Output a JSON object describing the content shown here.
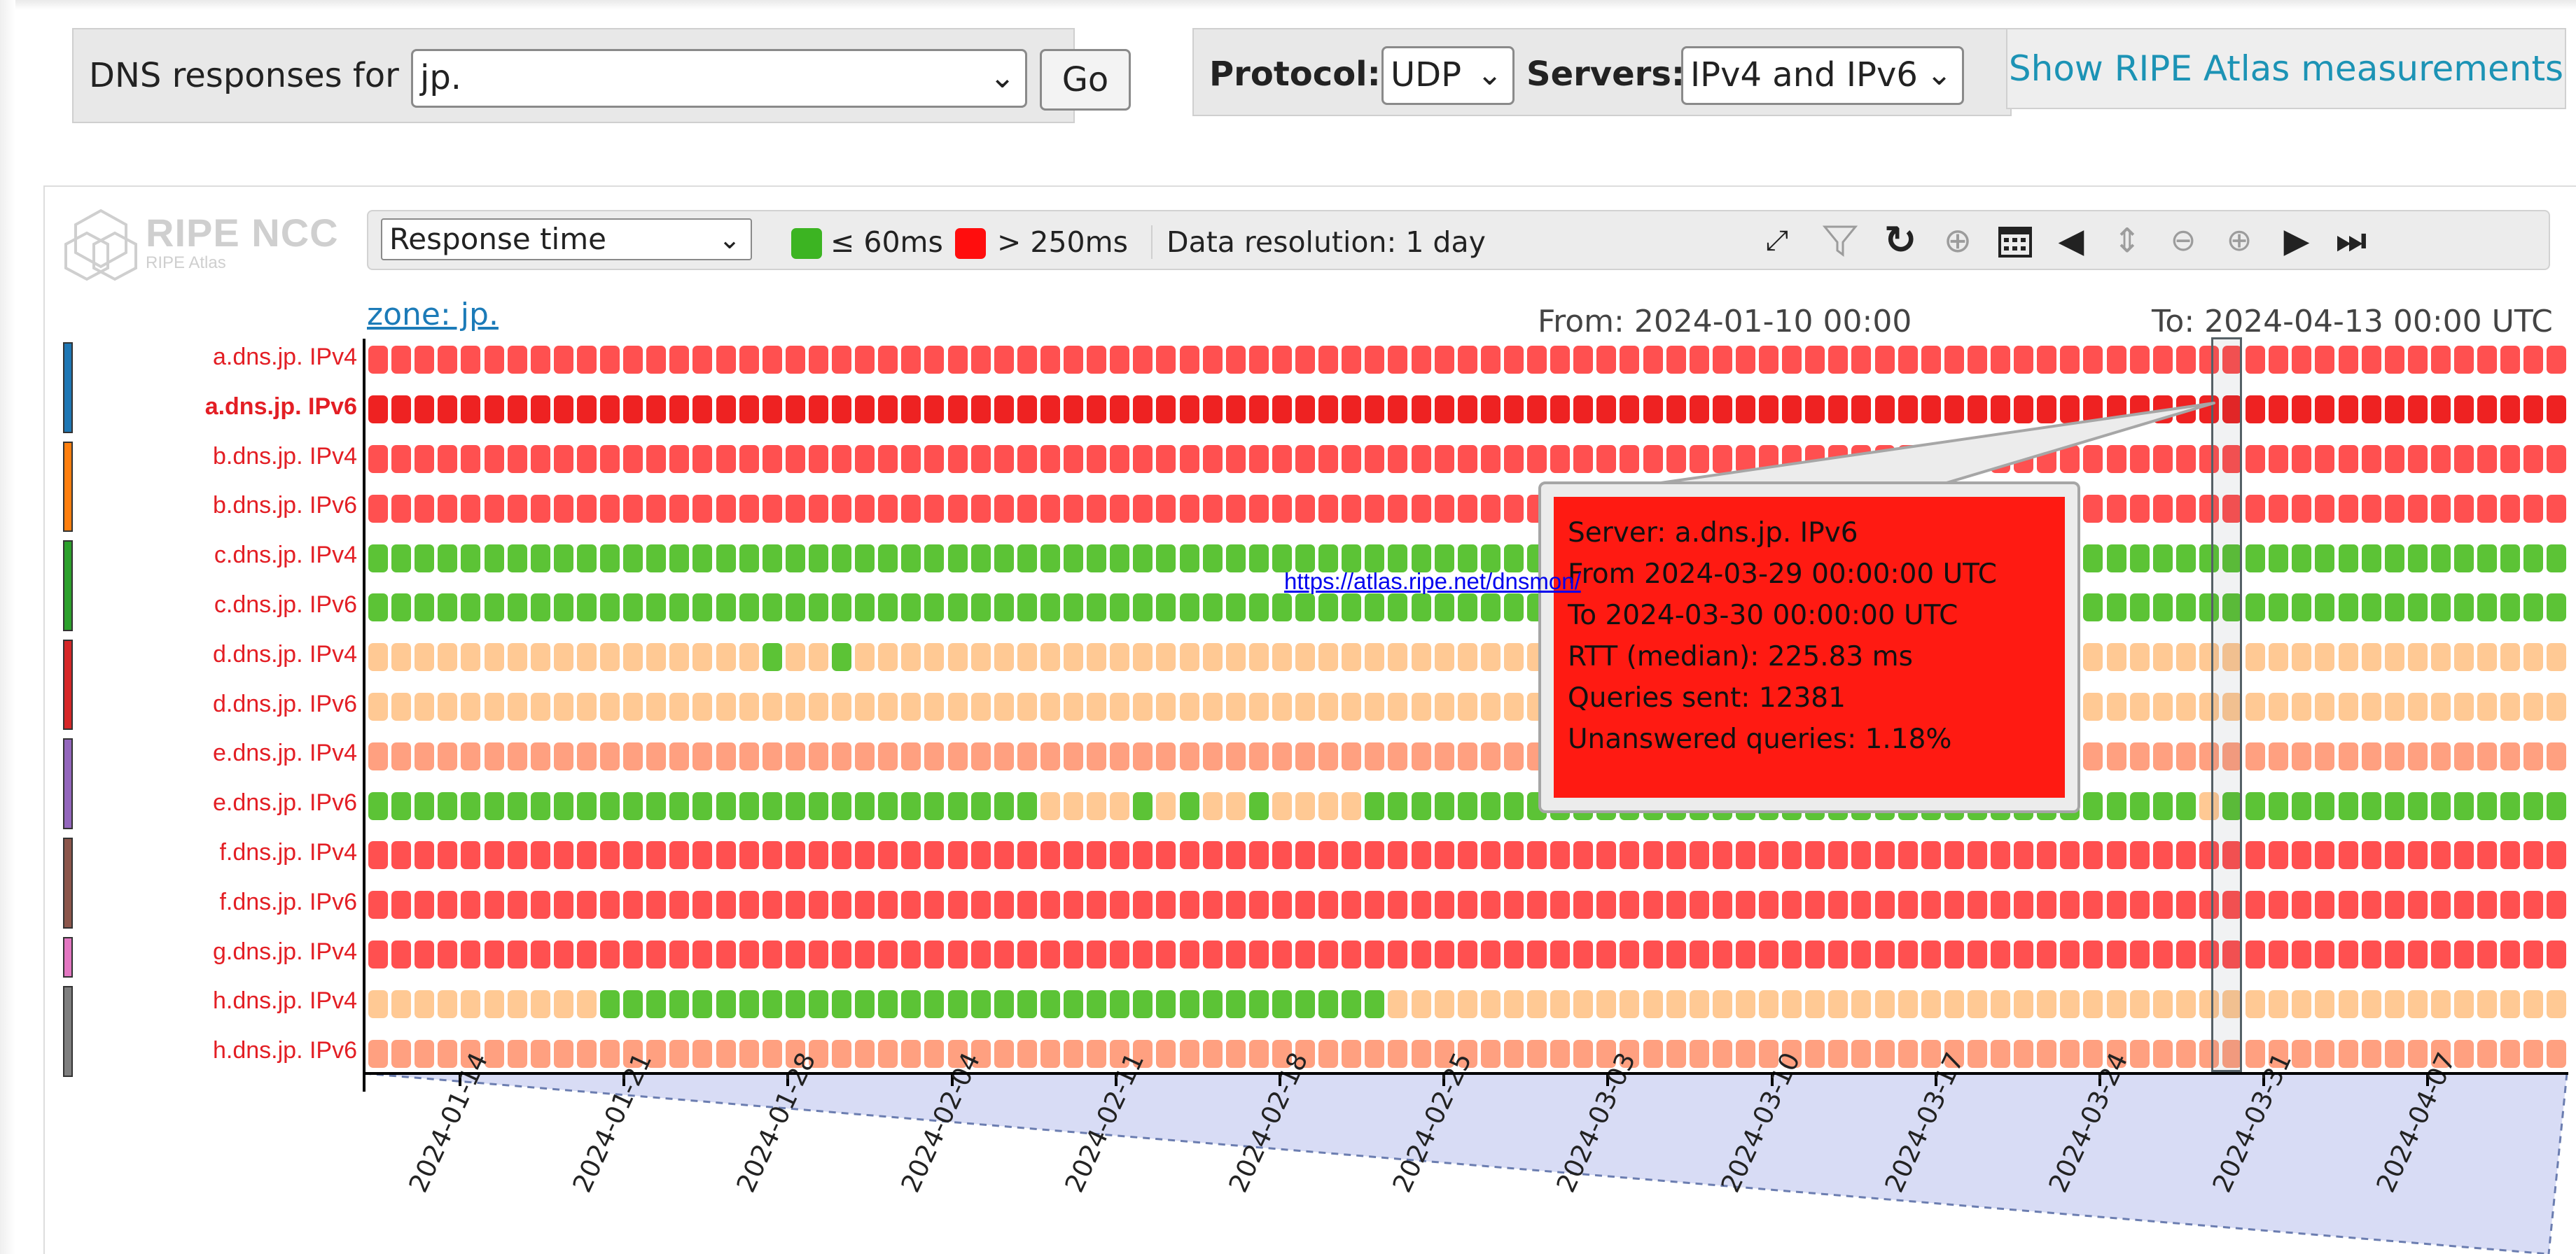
{
  "top_bar": {
    "dns_label": "DNS responses for",
    "zone_value": "jp.",
    "go_label": "Go",
    "protocol_label": "Protocol:",
    "protocol_value": "UDP",
    "servers_label": "Servers:",
    "servers_value": "IPv4 and IPv6",
    "ripe_button": "Show RIPE Atlas measurements"
  },
  "logo": {
    "name": "RIPE NCC",
    "sub": "RIPE Atlas"
  },
  "toolbar": {
    "metric_value": "Response time",
    "legend_good": "≤ 60ms",
    "legend_bad": "> 250ms",
    "resolution": "Data resolution: 1 day",
    "icons": [
      "fullscreen-icon",
      "filter-icon",
      "reload-icon",
      "pin-icon",
      "calendar-icon",
      "shift-left-icon",
      "shift-vertical-icon",
      "zoom-out-icon",
      "zoom-in-icon",
      "shift-right-icon",
      "go-to-end-icon"
    ],
    "colors": {
      "good": "#3cb422",
      "bad": "#ff0d0d"
    }
  },
  "chart": {
    "zone_link": "zone: jp.",
    "from": "From: 2024-01-10 00:00",
    "to": "To: 2024-04-13 00:00 UTC",
    "dnsmon_link": "https://atlas.ripe.net/dnsmon/",
    "servers": [
      "a.dns.jp. IPv4",
      "a.dns.jp. IPv6",
      "b.dns.jp. IPv4",
      "b.dns.jp. IPv6",
      "c.dns.jp. IPv4",
      "c.dns.jp. IPv6",
      "d.dns.jp. IPv4",
      "d.dns.jp. IPv6",
      "e.dns.jp. IPv4",
      "e.dns.jp. IPv6",
      "f.dns.jp. IPv4",
      "f.dns.jp. IPv6",
      "g.dns.jp. IPv4",
      "h.dns.jp. IPv4",
      "h.dns.jp. IPv6"
    ],
    "selected_server": "a.dns.jp. IPv6",
    "operator_colors": [
      "#1f77b4",
      "#ff7f0e",
      "#2ca02c",
      "#d62728",
      "#9467bd",
      "#8c564b",
      "#e377c2",
      "#7f7f7f"
    ],
    "date_ticks": [
      "2024-01-14",
      "2024-01-21",
      "2024-01-28",
      "2024-02-04",
      "2024-02-11",
      "2024-02-18",
      "2024-02-25",
      "2024-03-03",
      "2024-03-10",
      "2024-03-17",
      "2024-03-24",
      "2024-03-31",
      "2024-04-07"
    ],
    "cell_colors": {
      "red": "#ff5050",
      "dark_red": "#ee2222",
      "green": "#5cc336",
      "light_orange": "#ffc994",
      "salmon": "#ffa080"
    }
  },
  "tooltip": {
    "lines": [
      "Server: a.dns.jp. IPv6",
      "From 2024-03-29 00:00:00 UTC",
      "To 2024-03-30 00:00:00 UTC",
      "RTT (median): 225.83 ms",
      "Queries sent: 12381",
      "Unanswered queries: 1.18%"
    ]
  }
}
